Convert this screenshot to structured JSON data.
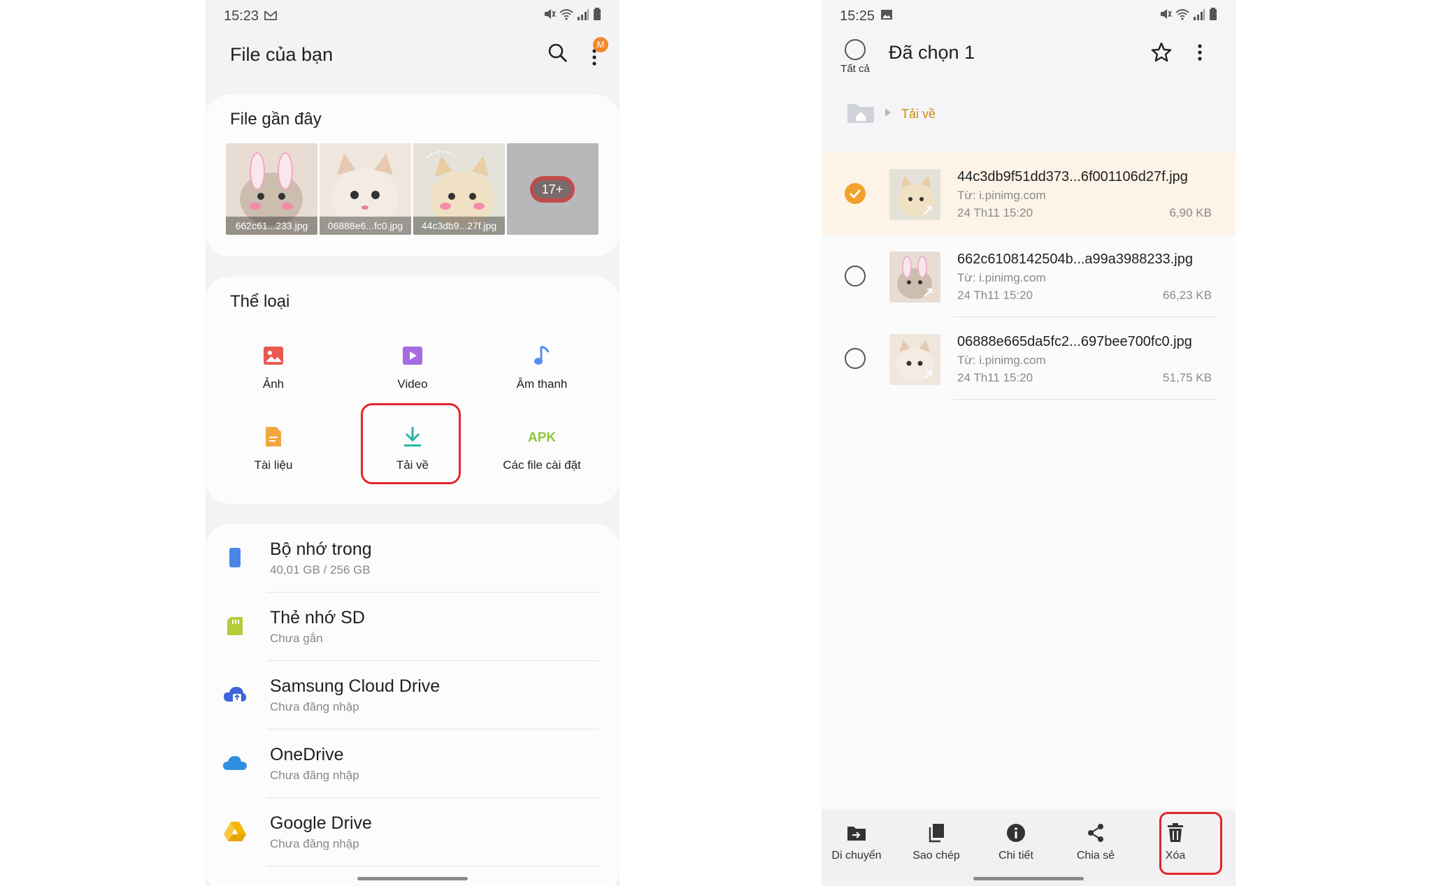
{
  "left": {
    "status": {
      "time": "15:23"
    },
    "appbar": {
      "title": "File của bạn",
      "badge": "M"
    },
    "recent": {
      "title": "File gần đây",
      "thumbs": [
        {
          "caption": "662c61...233.jpg"
        },
        {
          "caption": "06888e6...fc0.jpg"
        },
        {
          "caption": "44c3db9...27f.jpg"
        }
      ],
      "more_count": "17+"
    },
    "categories": {
      "title": "Thể loại",
      "items": [
        {
          "label": "Ảnh",
          "icon": "image-icon",
          "color": "#e85a4f"
        },
        {
          "label": "Video",
          "icon": "video-icon",
          "color": "#a56be0"
        },
        {
          "label": "Âm thanh",
          "icon": "music-note-icon",
          "color": "#5b8ef0"
        },
        {
          "label": "Tài liệu",
          "icon": "document-icon",
          "color": "#f1a640"
        },
        {
          "label": "Tải về",
          "icon": "download-icon",
          "color": "#2bb3a6"
        },
        {
          "label": "Các file cài đặt",
          "icon": "apk-icon",
          "icon_text": "APK",
          "color": "#8dc63f"
        }
      ]
    },
    "storage": [
      {
        "name": "Bộ nhớ trong",
        "sub": "40,01 GB / 256 GB",
        "icon": "phone-storage-icon",
        "color": "#4a86e8"
      },
      {
        "name": "Thẻ nhớ SD",
        "sub": "Chưa gắn",
        "icon": "sd-card-icon",
        "color": "#b5cc3a"
      },
      {
        "name": "Samsung Cloud Drive",
        "sub": "Chưa đăng nhập",
        "icon": "samsung-cloud-icon",
        "color": "#3d64d8"
      },
      {
        "name": "OneDrive",
        "sub": "Chưa đăng nhập",
        "icon": "onedrive-icon",
        "color": "#2f8fe0"
      },
      {
        "name": "Google Drive",
        "sub": "Chưa đăng nhập",
        "icon": "google-drive-icon",
        "color": "#f4b400"
      }
    ]
  },
  "right": {
    "status": {
      "time": "15:25"
    },
    "selection": {
      "select_all_label": "Tất cả",
      "title": "Đã chọn 1"
    },
    "breadcrumb": {
      "folder": "Tải về"
    },
    "files": [
      {
        "name": "44c3db9f51dd373...6f001106d27f.jpg",
        "source": "Từ: i.pinimg.com",
        "date": "24 Th11 15:20",
        "size": "6,90 KB",
        "selected": true
      },
      {
        "name": "662c6108142504b...a99a3988233.jpg",
        "source": "Từ: i.pinimg.com",
        "date": "24 Th11 15:20",
        "size": "66,23 KB",
        "selected": false
      },
      {
        "name": "06888e665da5fc2...697bee700fc0.jpg",
        "source": "Từ: i.pinimg.com",
        "date": "24 Th11 15:20",
        "size": "51,75 KB",
        "selected": false
      }
    ],
    "bottom_actions": [
      {
        "label": "Di chuyển",
        "icon": "move-folder-icon"
      },
      {
        "label": "Sao chép",
        "icon": "copy-icon"
      },
      {
        "label": "Chi tiết",
        "icon": "info-icon"
      },
      {
        "label": "Chia sẻ",
        "icon": "share-icon"
      },
      {
        "label": "Xóa",
        "icon": "trash-icon"
      }
    ]
  },
  "colors": {
    "highlight": "#e3252c",
    "accent": "#f2a12a",
    "folder_crumb": "#c78b0a"
  }
}
